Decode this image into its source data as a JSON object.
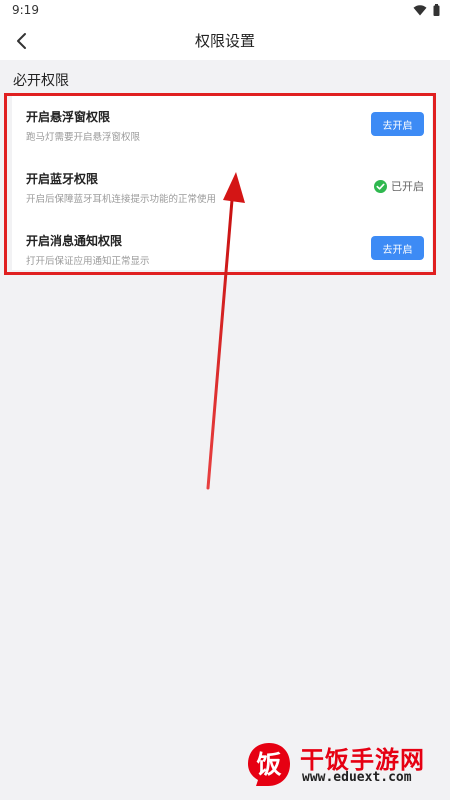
{
  "status_bar": {
    "time": "9:19",
    "icons": [
      "wifi-icon",
      "battery-icon"
    ]
  },
  "header": {
    "back_icon": "chevron-left-icon",
    "title": "权限设置"
  },
  "section": {
    "label": "必开权限"
  },
  "permissions": [
    {
      "title": "开启悬浮窗权限",
      "description": "跑马灯需要开启悬浮窗权限",
      "state": "disabled",
      "button_label": "去开启"
    },
    {
      "title": "开启蓝牙权限",
      "description": "开启后保障蓝牙耳机连接提示功能的正常使用",
      "state": "enabled",
      "status_label": "已开启"
    },
    {
      "title": "开启消息通知权限",
      "description": "打开后保证应用通知正常显示",
      "state": "disabled",
      "button_label": "去开启"
    }
  ],
  "colors": {
    "accent": "#3d8bf5",
    "enabled_check": "#2fb84f",
    "annotation_red": "#e02020",
    "page_background": "#f2f2f4"
  },
  "watermark": {
    "name": "干饭手游网",
    "url": "www.eduext.com",
    "logo_glyph": "饭"
  }
}
